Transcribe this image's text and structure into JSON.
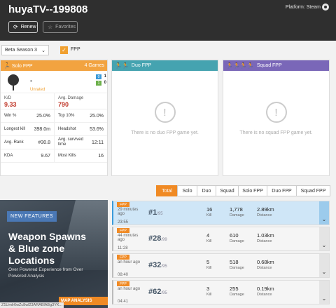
{
  "header": {
    "player_name": "huyaTV--199808",
    "platform": "Platform: Steam",
    "renew_label": "Renew",
    "favorites_label": "Favorites"
  },
  "filters": {
    "season": "Beta Season 3",
    "fpp_label": "FPP",
    "fpp_checked": true
  },
  "solo": {
    "title": "Solo FPP",
    "games": "4 Games",
    "tier_value": "-",
    "tier_name": "Unrated",
    "badge_a": "0",
    "badge_b": "1",
    "badge_a_val": "1",
    "badge_b_val": "0",
    "kd_label": "K/D",
    "kd_value": "9.33",
    "damage_label": "Avg. Damage",
    "damage_value": "790",
    "stats": [
      {
        "l1": "Win %",
        "v1": "25.0%",
        "l2": "Top 10%",
        "v2": "25.0%"
      },
      {
        "l1": "Longest kill",
        "v1": "398.0m",
        "l2": "Headshot",
        "v2": "53.6%"
      },
      {
        "l1": "Avg. Rank",
        "v1": "#30.8",
        "l2": "Avg. survived time",
        "v2": "12:11"
      },
      {
        "l1": "KDA",
        "v1": "9.67",
        "l2": "Most Kills",
        "v2": "16"
      }
    ]
  },
  "duo": {
    "title": "Duo FPP",
    "empty_icon": "!",
    "empty_msg": "There is no duo FPP game yet."
  },
  "squad": {
    "title": "Squad FPP",
    "empty_icon": "!",
    "empty_msg": "There is no squad FPP game yet."
  },
  "tabs": [
    "Total",
    "Solo",
    "Duo",
    "Squad",
    "Solo FPP",
    "Duo FPP",
    "Squad FPP"
  ],
  "active_tab": "Total",
  "ad": {
    "tag": "NEW FEATURES",
    "title": "Weapon Spawns & Blue zone Locations",
    "subtitle": "Over Powered Experience from Over Powered Analysis",
    "cta": "MAP ANALYSIS",
    "url": "Z1Umlr6wZc8wl23ARABlABg3YK..."
  },
  "matches": [
    {
      "mode": "FPP",
      "ago": "29 minutes ago",
      "duration": "23:55",
      "rank": "#1",
      "total": "/95",
      "kills": "16",
      "damage": "1,778",
      "distance": "2.89km"
    },
    {
      "mode": "FPP",
      "ago": "44 minutes ago",
      "duration": "11:28",
      "rank": "#28",
      "total": "/99",
      "kills": "4",
      "damage": "610",
      "distance": "1.03km"
    },
    {
      "mode": "FPP",
      "ago": "an hour ago",
      "duration": "08:40",
      "rank": "#32",
      "total": "/95",
      "kills": "5",
      "damage": "518",
      "distance": "0.68km"
    },
    {
      "mode": "FPP",
      "ago": "an hour ago",
      "duration": "04:41",
      "rank": "#62",
      "total": "/95",
      "kills": "3",
      "damage": "255",
      "distance": "0.19km"
    }
  ],
  "match_labels": {
    "kills": "Kill",
    "damage": "Damage",
    "distance": "Distance"
  },
  "colors": {
    "accent": "#f08a24",
    "solo": "#f2a340",
    "duo": "#45a3b0",
    "squad": "#7a67b8",
    "header": "#2f2f2f"
  }
}
